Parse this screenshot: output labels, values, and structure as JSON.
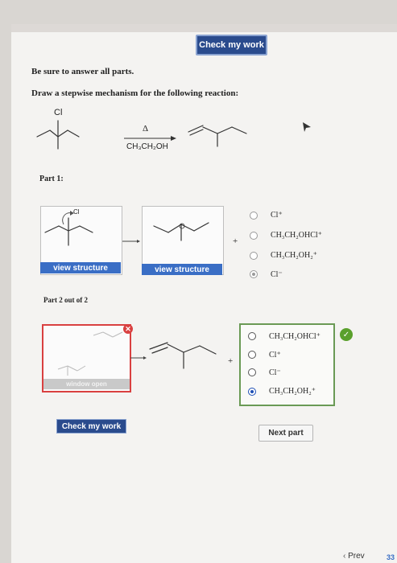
{
  "header": {
    "check_label": "Check my work"
  },
  "instructions": {
    "answer_all": "Be sure to answer all parts.",
    "prompt": "Draw a stepwise mechanism for the following reaction:"
  },
  "reaction": {
    "reactant_atom": "Cl",
    "condition_heat": "Δ",
    "solvent": "CH₃CH₂OH"
  },
  "part1": {
    "label": "Part 1:",
    "atom_label": "Cl",
    "view_structure_1": "view structure",
    "view_structure_2": "view structure",
    "plus": "+",
    "options": [
      "Cl⁺",
      "CH₃CH₂OHCl⁺",
      "CH₃CH₂OH₂⁺",
      "Cl⁻"
    ],
    "selected_index": 3
  },
  "part2": {
    "label": "Part 2 out of 2",
    "window_open_label": "window open",
    "plus": "+",
    "options": [
      "CH₃CH₂OHCl⁺",
      "Cl⁺",
      "Cl⁻",
      "CH₃CH₂OH₂⁺"
    ],
    "selected_index": 3,
    "check_label": "Check my work",
    "next_label": "Next part"
  },
  "footer": {
    "prev_label": "Prev",
    "page_fragment": "33"
  },
  "colors": {
    "primary": "#2a4b8d",
    "link_blue": "#3a6ec5",
    "correct_green": "#5aa02c",
    "error_red": "#d94040",
    "option_border": "#6a9a55"
  }
}
